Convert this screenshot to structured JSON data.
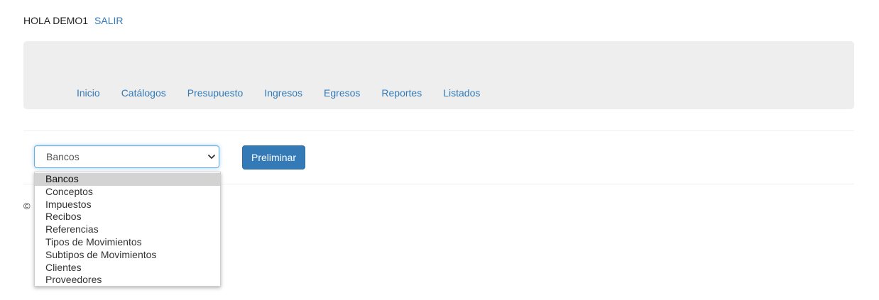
{
  "header": {
    "greeting": "HOLA DEMO1",
    "logout_label": "SALIR"
  },
  "nav": {
    "items": [
      "Inicio",
      "Catálogos",
      "Presupuesto",
      "Ingresos",
      "Egresos",
      "Reportes",
      "Listados"
    ]
  },
  "report_select": {
    "selected": "Bancos",
    "options": [
      "Bancos",
      "Conceptos",
      "Impuestos",
      "Recibos",
      "Referencias",
      "Tipos de Movimientos",
      "Subtipos de Movimientos",
      "Clientes",
      "Proveedores"
    ]
  },
  "preview_button": {
    "label": "Preliminar"
  },
  "footer": {
    "text": "©"
  },
  "icons": {
    "select_arrow": "chevron-down-icon"
  },
  "colors": {
    "link": "#337ab7",
    "navbar_bg": "#eeeeee",
    "button_bg": "#337ab7",
    "focus_border": "#66afe9",
    "option_highlight": "#d3d3d3"
  }
}
